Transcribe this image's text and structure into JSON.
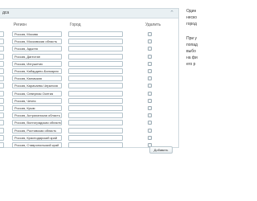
{
  "panel": {
    "title": "дса",
    "collapse_icon": "collapse-icon"
  },
  "columns": {
    "region": "Регион",
    "city": "Город",
    "delete": "Удалить"
  },
  "rows": [
    {
      "region": "Россия, Москва",
      "city": ""
    },
    {
      "region": "Россия, Московская область",
      "city": ""
    },
    {
      "region": "Россия, Адыгея",
      "city": ""
    },
    {
      "region": "Россия, Дагестан",
      "city": ""
    },
    {
      "region": "Россия, Ингушетия",
      "city": ""
    },
    {
      "region": "Россия, Кабардино-Балкария",
      "city": ""
    },
    {
      "region": "Россия, Калмыкия",
      "city": ""
    },
    {
      "region": "Россия, Карачаево-Черкесия",
      "city": ""
    },
    {
      "region": "Россия, Северная Осетия",
      "city": ""
    },
    {
      "region": "Россия, Чечня",
      "city": ""
    },
    {
      "region": "Россия, Крым",
      "city": ""
    },
    {
      "region": "Россия, Астраханская область",
      "city": ""
    },
    {
      "region": "Россия, Волгоградская область",
      "city": ""
    },
    {
      "region": "Россия, Ростовская область",
      "city": ""
    },
    {
      "region": "Россия, Краснодарский край",
      "city": ""
    },
    {
      "region": "Россия, Ставропольский край",
      "city": ""
    }
  ],
  "add_button": "Добавить",
  "side_text": [
    "Один",
    "неско",
    "город",
    "",
    "При у",
    "попад",
    "выбо",
    "на фи",
    "его р"
  ],
  "colors": {
    "header_bg": "#e9f0f3",
    "border": "#cfd9de",
    "field_border": "#b4c3cb"
  }
}
